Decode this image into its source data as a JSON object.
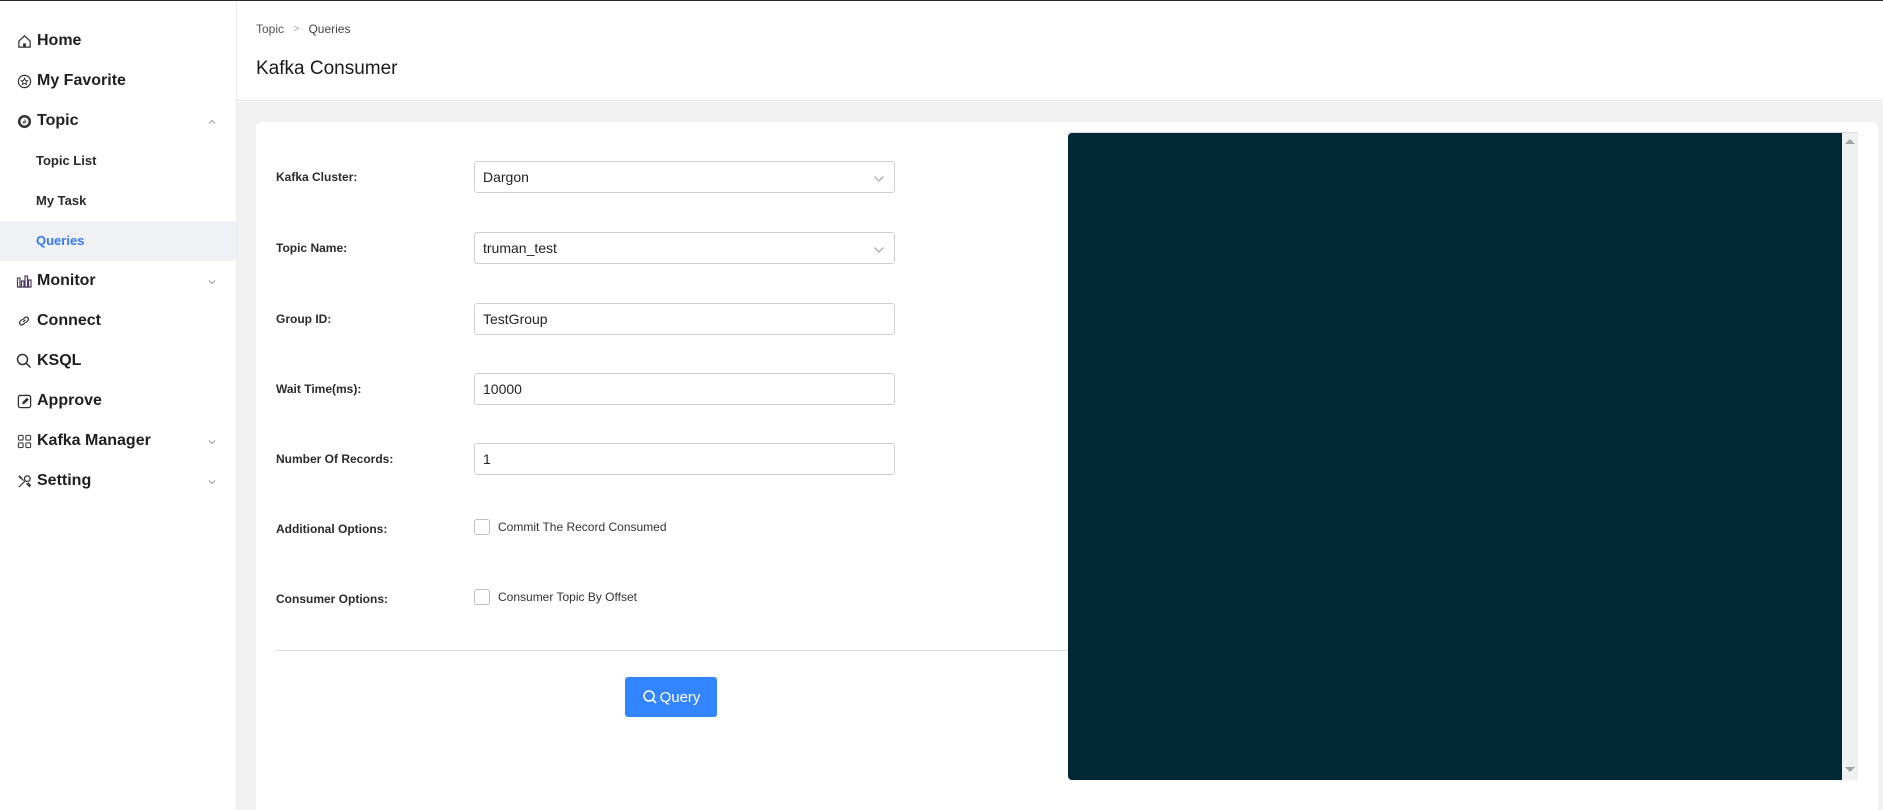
{
  "sidebar": {
    "items": [
      {
        "label": "Home",
        "icon": "home-icon",
        "expandable": false
      },
      {
        "label": "My Favorite",
        "icon": "favorite-icon",
        "expandable": false
      },
      {
        "label": "Topic",
        "icon": "topic-icon",
        "expandable": true,
        "expanded": true,
        "children": [
          {
            "label": "Topic List",
            "active": false
          },
          {
            "label": "My Task",
            "active": false
          },
          {
            "label": "Queries",
            "active": true
          }
        ]
      },
      {
        "label": "Monitor",
        "icon": "monitor-icon",
        "expandable": true,
        "expanded": false
      },
      {
        "label": "Connect",
        "icon": "link-icon",
        "expandable": false
      },
      {
        "label": "KSQL",
        "icon": "search-icon",
        "expandable": false
      },
      {
        "label": "Approve",
        "icon": "edit-icon",
        "expandable": false
      },
      {
        "label": "Kafka Manager",
        "icon": "grid-icon",
        "expandable": true,
        "expanded": false
      },
      {
        "label": "Setting",
        "icon": "tools-icon",
        "expandable": true,
        "expanded": false
      }
    ]
  },
  "header": {
    "breadcrumb": [
      "Topic",
      "Queries"
    ],
    "title": "Kafka Consumer"
  },
  "form": {
    "kafka_cluster": {
      "label": "Kafka Cluster:",
      "value": "Dargon"
    },
    "topic_name": {
      "label": "Topic Name:",
      "value": "truman_test"
    },
    "group_id": {
      "label": "Group ID:",
      "value": "TestGroup"
    },
    "wait_time": {
      "label": "Wait Time(ms):",
      "value": "10000"
    },
    "num_records": {
      "label": "Number Of Records:",
      "value": "1"
    },
    "additional_options": {
      "label": "Additional Options:",
      "checkbox_label": "Commit The Record Consumed",
      "checked": false
    },
    "consumer_options": {
      "label": "Consumer Options:",
      "checkbox_label": "Consumer Topic By Offset",
      "checked": false
    },
    "query_button": "Query"
  },
  "colors": {
    "accent": "#3385ff",
    "active_nav": "#3478f6",
    "terminal_bg": "#022836"
  }
}
